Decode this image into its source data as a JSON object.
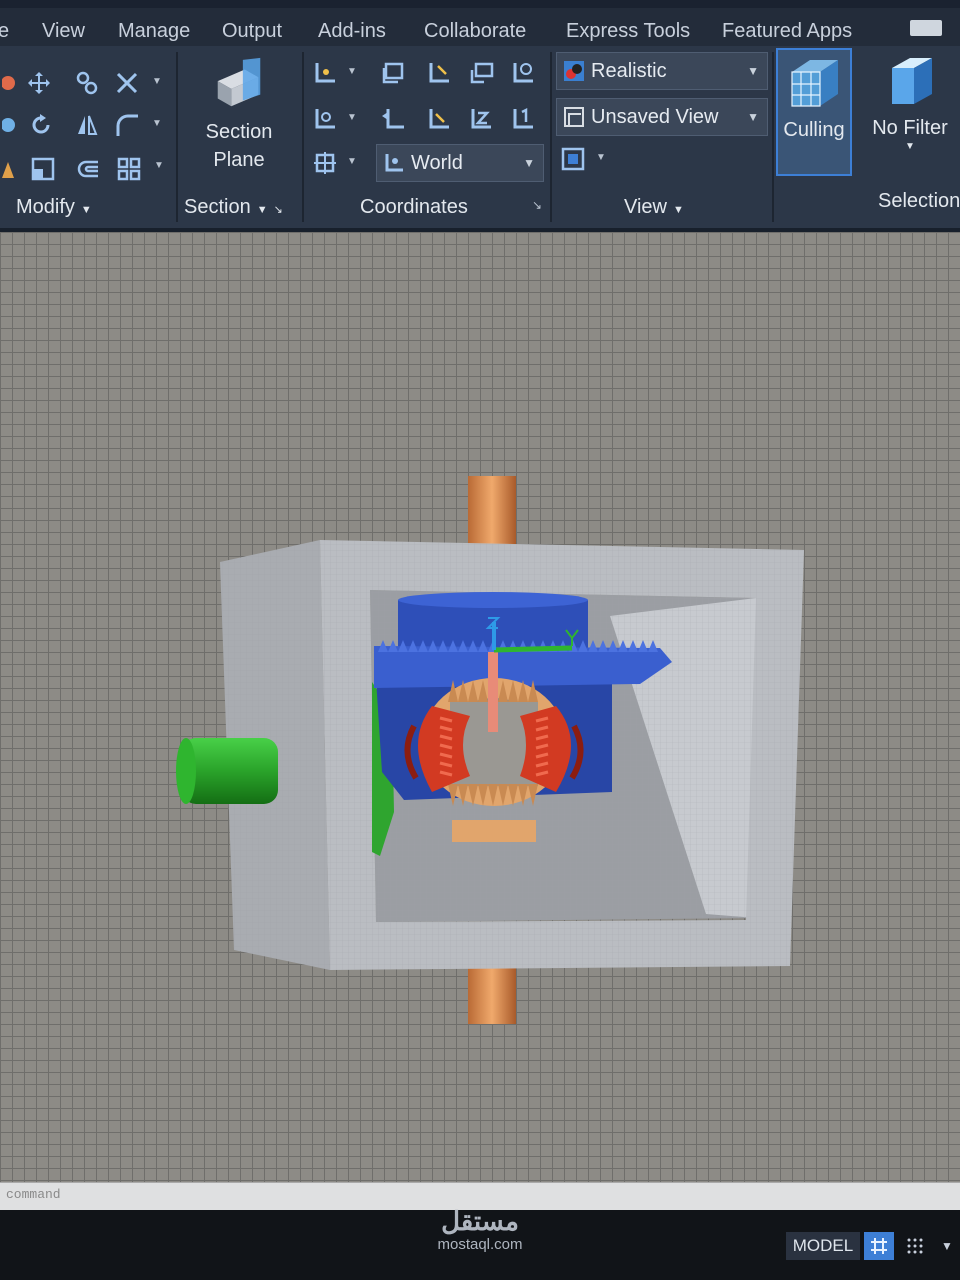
{
  "ribbon_tabs": [
    "e",
    "View",
    "Manage",
    "Output",
    "Add-ins",
    "Collaborate",
    "Express Tools",
    "Featured Apps"
  ],
  "panels": {
    "modify": "Modify",
    "section": "Section",
    "coordinates": "Coordinates",
    "view": "View",
    "selection": "Selection"
  },
  "section_plane": {
    "line1": "Section",
    "line2": "Plane"
  },
  "ucs_combo": {
    "value": "World"
  },
  "visual_style_combo": {
    "value": "Realistic"
  },
  "named_view_combo": {
    "value": "Unsaved View"
  },
  "culling": {
    "label": "Culling"
  },
  "no_filter": {
    "label": "No Filter"
  },
  "command_line": {
    "placeholder": "command"
  },
  "status": {
    "model": "MODEL"
  },
  "watermark": {
    "arabic": "مستقل",
    "latin": "mostaql.com"
  },
  "colors": {
    "ribbon_bg": "#2c3748",
    "tab_bar_bg": "#232c3a",
    "viewport_bg": "#8d8b86",
    "housing": "#b9bcc0",
    "carrier": "#2e4fb8",
    "bevel_gears": "#d23a22",
    "pinion_shaft": "#2fb52f",
    "axle": "#d9894e",
    "active_button": "#3d7fd6"
  },
  "icons": {
    "modify": [
      "move-icon",
      "copy-icon",
      "trim-icon",
      "rotate-icon",
      "mirror-icon",
      "fillet-icon",
      "scale-icon",
      "offset-icon",
      "array-icon"
    ],
    "coordinates": [
      "ucs-icon",
      "ucs-face-icon",
      "ucs-x-icon",
      "ucs-object-icon",
      "ucs-3point-icon",
      "ucs-view-icon",
      "ucs-previous-icon",
      "ucs-y-icon",
      "ucs-z-icon",
      "ucs-zaxis-icon",
      "ucs-named-icon",
      "ucs-world-icon"
    ],
    "view": [
      "realistic-style-icon",
      "named-view-icon",
      "viewport-config-icon"
    ]
  }
}
